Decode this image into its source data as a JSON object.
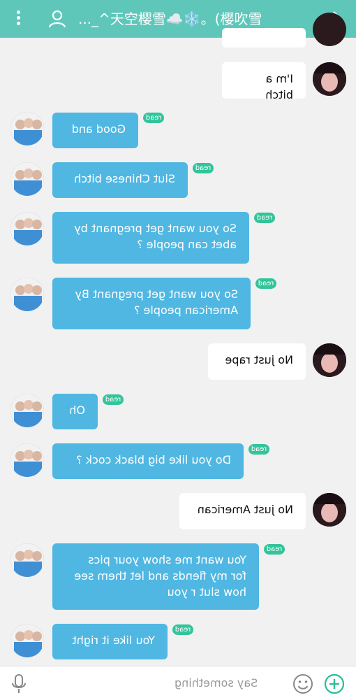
{
  "header": {
    "title": "天空樱雪☁️❄️。(樱吹雪^_...",
    "menu_icon": "vertical-dots-icon",
    "profile_icon": "person-icon",
    "forward_icon": "chevron-right-icon"
  },
  "messages": [
    {
      "from": "me",
      "text": "I'm a bitch"
    },
    {
      "from": "them",
      "text": "Good and",
      "status": "read"
    },
    {
      "from": "them",
      "text": "Slut Chinese bitch",
      "status": "read"
    },
    {
      "from": "them",
      "text": "So you want get pregnant by\nabet can people ?",
      "status": "read"
    },
    {
      "from": "them",
      "text": "So you want get pregnant By\nAmerican people ?",
      "status": "read"
    },
    {
      "from": "me",
      "text": "No just rape"
    },
    {
      "from": "them",
      "text": "Oh",
      "status": "read"
    },
    {
      "from": "them",
      "text": "Do you like big black cock ?",
      "status": "read"
    },
    {
      "from": "me",
      "text": "No just American"
    },
    {
      "from": "them",
      "text": "You want me show your pics\nfor my fiends and let them see\nhow slut r you",
      "status": "read"
    },
    {
      "from": "them",
      "text": "You like it right",
      "status": "read"
    }
  ],
  "composer": {
    "placeholder": "Say something",
    "mic_icon": "microphone-icon",
    "emoji_icon": "smiley-icon",
    "add_icon": "plus-circle-icon"
  },
  "colors": {
    "header": "#5ec7ba",
    "their_bubble": "#50b7e2",
    "my_bubble": "#ffffff",
    "read_badge": "#32c49a",
    "background": "#f1f1f1"
  }
}
